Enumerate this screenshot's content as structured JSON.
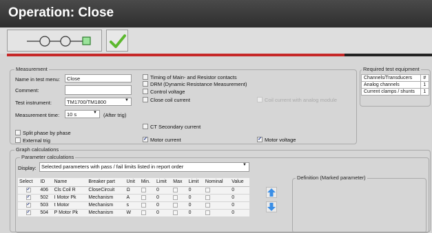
{
  "window": {
    "title": "Operation: Close"
  },
  "toolbar": {
    "sequence_icon": "o-o-square-sequence-icon",
    "apply_icon": "green-checkmark-icon",
    "accent": "#c62828",
    "check_color": "#5cb82e"
  },
  "measurement": {
    "legend": "Measurement",
    "name_label": "Name in test menu:",
    "name_value": "Close",
    "comment_label": "Comment:",
    "comment_value": "",
    "instrument_label": "Test instrument:",
    "instrument_value": "TM1700/TM1800",
    "time_label": "Measurement time:",
    "time_value": "10 s",
    "time_suffix": "(After trig)",
    "split_phase": "Split phase by phase",
    "external_trig": "External trig",
    "options": {
      "timing": "Timing of Main- and Resistor contacts",
      "drm": "DRM (Dynamic Resistance Measurement)",
      "control_voltage": "Control voltage",
      "close_coil_current": "Close coil current",
      "coil_analog": "Coil current with analog module",
      "ct_secondary": "CT Secondary current",
      "motor_current": "Motor current",
      "motor_voltage": "Motor voltage"
    }
  },
  "equipment": {
    "legend": "Required test equipment",
    "header_col1": "Channels/Transducers",
    "header_col2": "#",
    "rows": [
      {
        "name": "Analog channels",
        "count": "1"
      },
      {
        "name": "Current clamps / shunts",
        "count": "1"
      }
    ]
  },
  "graph": {
    "legend": "Graph calculations",
    "param_legend": "Parameter calculations",
    "display_label": "Display:",
    "display_value": "Selected parameters with pass / fail limits listed in report order",
    "definition_legend": "Definition (Marked parameter)",
    "columns": [
      "Select",
      "ID",
      "Name",
      "Breaker part",
      "Unit",
      "Min.",
      "Limit",
      "Max",
      "Limit",
      "Nominal",
      "Value"
    ],
    "rows": [
      {
        "id": "406",
        "name": "Cls Coil R",
        "part": "CloseCircuit",
        "unit": "Ω",
        "min_limit": "0",
        "max_limit": "0",
        "value": "0"
      },
      {
        "id": "502",
        "name": "I Motor Pk",
        "part": "Mechanism",
        "unit": "A",
        "min_limit": "0",
        "max_limit": "0",
        "value": "0"
      },
      {
        "id": "503",
        "name": "t Motor",
        "part": "Mechanism",
        "unit": "s",
        "min_limit": "0",
        "max_limit": "0",
        "value": "0"
      },
      {
        "id": "504",
        "name": "P Motor Pk",
        "part": "Mechanism",
        "unit": "W",
        "min_limit": "0",
        "max_limit": "0",
        "value": "0"
      }
    ]
  }
}
